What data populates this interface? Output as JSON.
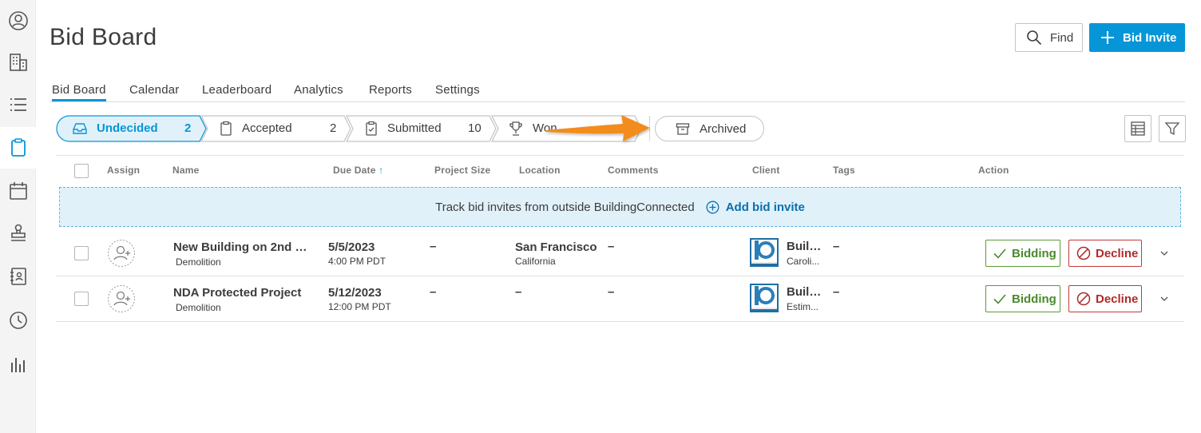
{
  "sidebar": {
    "items": [
      {
        "icon": "user-circle-icon"
      },
      {
        "icon": "building-icon"
      },
      {
        "icon": "list-icon"
      },
      {
        "icon": "clipboard-icon",
        "active": true
      },
      {
        "icon": "calendar-icon"
      },
      {
        "icon": "stamp-icon"
      },
      {
        "icon": "contacts-book-icon"
      },
      {
        "icon": "clock-icon"
      },
      {
        "icon": "bar-chart-icon"
      }
    ]
  },
  "header": {
    "title": "Bid Board",
    "find_label": "Find",
    "bid_invite_label": "Bid Invite"
  },
  "tabs": [
    {
      "label": "Bid Board",
      "active": true
    },
    {
      "label": "Calendar"
    },
    {
      "label": "Leaderboard"
    },
    {
      "label": "Analytics"
    },
    {
      "label": "Reports"
    },
    {
      "label": "Settings"
    }
  ],
  "stages": [
    {
      "label": "Undecided",
      "count": "2",
      "active": true,
      "icon": "inbox-tray-icon"
    },
    {
      "label": "Accepted",
      "count": "2",
      "icon": "clipboard-icon"
    },
    {
      "label": "Submitted",
      "count": "10",
      "icon": "clipboard-check-icon"
    },
    {
      "label": "Won",
      "count": "",
      "icon": "trophy-icon"
    }
  ],
  "archived_label": "Archived",
  "columns": {
    "assign": "Assign",
    "name": "Name",
    "due_date": "Due Date",
    "project_size": "Project Size",
    "location": "Location",
    "comments": "Comments",
    "client": "Client",
    "tags": "Tags",
    "action": "Action"
  },
  "banner": {
    "text": "Track bid invites from outside BuildingConnected",
    "add_label": "Add bid invite"
  },
  "rows": [
    {
      "name": "New Building on 2nd St...",
      "trade": "Demolition",
      "due_date": "5/5/2023",
      "due_time": "4:00 PM PDT",
      "project_size": "–",
      "location_city": "San Francisco",
      "location_state": "California",
      "comments": "–",
      "client_name": "Build...",
      "client_contact": "Caroli...",
      "tags": "–",
      "bidding_label": "Bidding",
      "decline_label": "Decline"
    },
    {
      "name": "NDA Protected Project",
      "trade": "Demolition",
      "due_date": "5/12/2023",
      "due_time": "12:00 PM PDT",
      "project_size": "–",
      "location_city": "–",
      "location_state": "",
      "comments": "–",
      "client_name": "Build...",
      "client_contact": "Estim...",
      "tags": "–",
      "bidding_label": "Bidding",
      "decline_label": "Decline"
    }
  ],
  "colors": {
    "accent": "#0696d7",
    "bidding": "#4a8a2c",
    "decline": "#b02a2a",
    "banner_bg": "#e1f1fa",
    "annotation_arrow": "#f28c1e"
  }
}
